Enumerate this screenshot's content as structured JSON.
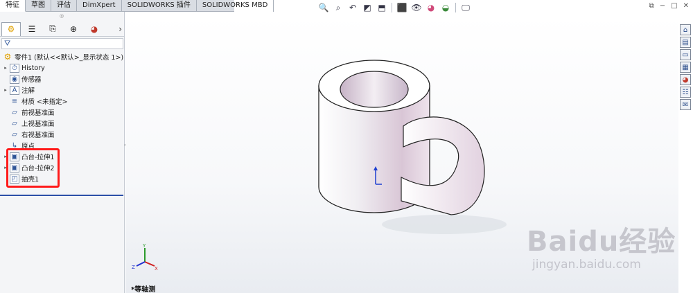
{
  "tabs": [
    "特征",
    "草图",
    "评估",
    "DimXpert",
    "SOLIDWORKS 插件",
    "SOLIDWORKS MBD"
  ],
  "active_tab": 0,
  "hud_icons": [
    "zoom-to-fit-icon",
    "zoom-area-icon",
    "previous-view-icon",
    "section-view-icon",
    "view-orientation-icon",
    "display-style-icon",
    "hide-show-icon",
    "edit-appearance-icon",
    "scene-icon",
    "view-settings-icon"
  ],
  "window_controls": [
    "⧉",
    "−",
    "□",
    "✕"
  ],
  "panel_tabs": [
    "feature-manager-icon",
    "property-manager-icon",
    "configuration-manager-icon",
    "dimxpert-manager-icon",
    "display-manager-icon"
  ],
  "tree": {
    "root": "零件1  (默认<<默认>_显示状态 1>)",
    "items": [
      {
        "label": "History",
        "icon": "history-icon",
        "arrow": true
      },
      {
        "label": "传感器",
        "icon": "sensor-icon",
        "arrow": false
      },
      {
        "label": "注解",
        "icon": "annotation-icon",
        "arrow": true
      },
      {
        "label": "材质 <未指定>",
        "icon": "material-icon",
        "arrow": false
      },
      {
        "label": "前视基准面",
        "icon": "plane-icon",
        "arrow": false
      },
      {
        "label": "上视基准面",
        "icon": "plane-icon",
        "arrow": false
      },
      {
        "label": "右视基准面",
        "icon": "plane-icon",
        "arrow": false
      },
      {
        "label": "原点",
        "icon": "origin-icon",
        "arrow": false
      },
      {
        "label": "凸台-拉伸1",
        "icon": "extrude-icon",
        "arrow": true
      },
      {
        "label": "凸台-拉伸2",
        "icon": "extrude-icon",
        "arrow": true
      },
      {
        "label": "抽壳1",
        "icon": "shell-icon",
        "arrow": false
      }
    ]
  },
  "view_label": "*等轴测",
  "triad": {
    "x": "X",
    "y": "Y",
    "z": "Z"
  },
  "taskpane_icons": [
    "home-icon",
    "design-library-icon",
    "file-explorer-icon",
    "view-palette-icon",
    "appearances-icon",
    "custom-properties-icon",
    "forum-icon"
  ],
  "watermark": {
    "brand": "Baidu经验",
    "url": "jingyan.baidu.com"
  },
  "colors": {
    "highlight": "#ff1a1a",
    "rollback": "#2b4fa8"
  }
}
